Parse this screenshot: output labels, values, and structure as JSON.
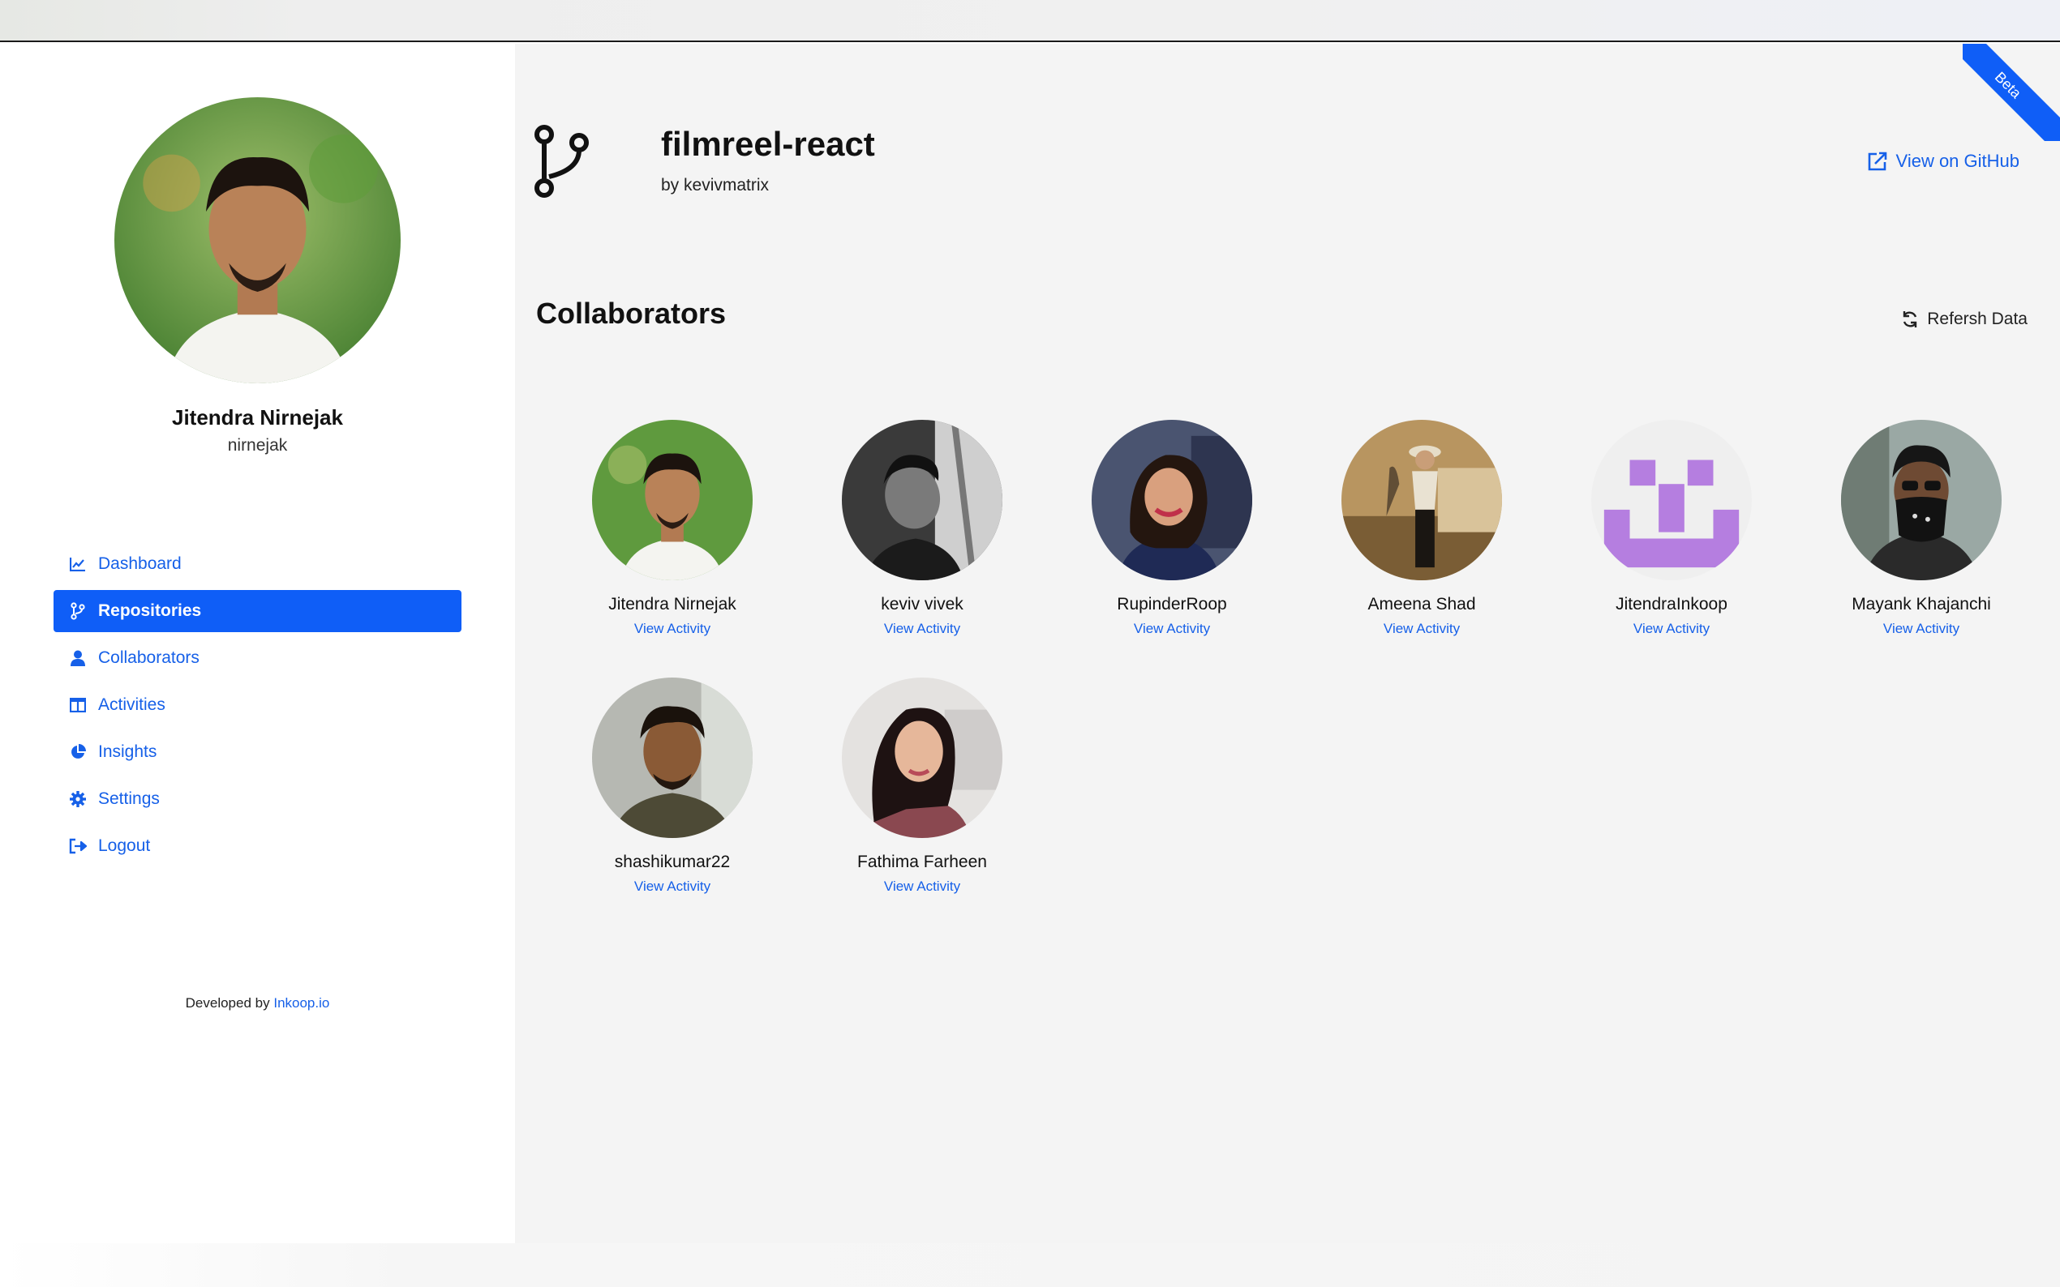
{
  "sidebar": {
    "profile": {
      "name": "Jitendra Nirnejak",
      "username": "nirnejak"
    },
    "nav": [
      {
        "label": "Dashboard",
        "icon": "chart-line-icon"
      },
      {
        "label": "Repositories",
        "icon": "branch-icon",
        "active": true
      },
      {
        "label": "Collaborators",
        "icon": "user-icon"
      },
      {
        "label": "Activities",
        "icon": "columns-icon"
      },
      {
        "label": "Insights",
        "icon": "pie-chart-icon"
      },
      {
        "label": "Settings",
        "icon": "gear-icon"
      },
      {
        "label": "Logout",
        "icon": "sign-out-icon"
      }
    ],
    "footer": {
      "prefix": "Developed by",
      "link": "Inkoop.io"
    }
  },
  "repo": {
    "title": "filmreel-react",
    "owner_prefix": "by",
    "owner": "kevivmatrix",
    "github_link": "View on GitHub",
    "ribbon": "Beta"
  },
  "collaborators": {
    "heading": "Collaborators",
    "refresh_label": "Refersh Data",
    "activity_label": "View Activity",
    "items": [
      {
        "name": "Jitendra Nirnejak"
      },
      {
        "name": "keviv vivek"
      },
      {
        "name": "RupinderRoop"
      },
      {
        "name": "Ameena Shad"
      },
      {
        "name": "JitendraInkoop"
      },
      {
        "name": "Mayank Khajanchi"
      },
      {
        "name": "shashikumar22"
      },
      {
        "name": "Fathima Farheen"
      }
    ]
  },
  "colors": {
    "accent": "#0f5ef7",
    "link": "#1660e8",
    "main_bg": "#f4f4f4",
    "identicon": "#b57ee0"
  }
}
